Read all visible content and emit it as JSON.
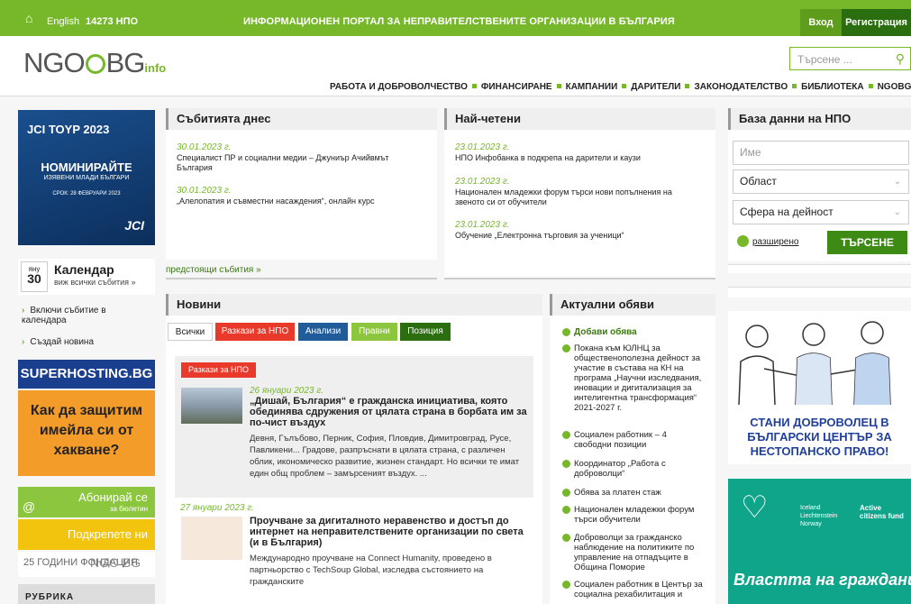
{
  "topbar": {
    "home_icon": "home-icon",
    "lang": "English",
    "count": "14273 НПО",
    "portal": "ИНФОРМАЦИОНЕН ПОРТАЛ ЗА НЕПРАВИТЕЛСТВЕНИТЕ ОРГАНИЗАЦИИ В БЪЛГАРИЯ",
    "login": "Вход",
    "register": "Регистрация"
  },
  "header": {
    "logo_main": "NGO",
    "logo_bg": "BG",
    "logo_info": "info",
    "search_placeholder": "Търсене ..."
  },
  "nav": [
    "РАБОТА И ДОБРОВОЛЧЕСТВО",
    "ФИНАНСИРАНЕ",
    "КАМПАНИИ",
    "ДАРИТЕЛИ",
    "ЗАКОНОДАТЕЛСТВО",
    "БИБЛИОТЕКА",
    "NGOBG Live"
  ],
  "left": {
    "jci": {
      "logo": "JCI TOYP 2023",
      "title": "НОМИНИРАЙТЕ",
      "subtitle": "ИЗЯВЕНИ МЛАДИ БЪЛГАРИ",
      "deadline": "СРОК: 28 ФЕВРУАРИ 2023",
      "brand": "JCI"
    },
    "calendar": {
      "month": "яну",
      "day": "30",
      "title": "Календар",
      "sub": "виж всички събития »"
    },
    "links": [
      "Включи събитие в календара",
      "Създай новина"
    ],
    "superhosting": "SUPERHOSTING.BG",
    "superhosting_text": "Как да защитим имейла си от хакване?",
    "subscribe": "Абонирай се",
    "subscribe_sub": "за бюлетин",
    "support": "Подкрепете ни",
    "anniv": "25 ГОДИНИ ФОНДАЦИЯ",
    "anniv_logo": "NGO BG",
    "rubric": "РУБРИКА"
  },
  "events": {
    "title": "Събитията днес",
    "items": [
      {
        "date": "30.01.2023 г.",
        "text": "Специалист ПР и социални медии – Джуниър Ачийвмът България"
      },
      {
        "date": "30.01.2023 г.",
        "text": "„Алелопатия и съвместни насаждения“, онлайн курс"
      }
    ],
    "upcoming": "предстоящи събития »"
  },
  "popular": {
    "title": "Най-четени",
    "items": [
      {
        "date": "23.01.2023 г.",
        "text": "НПО Инфобанка в подкрепа на дарители и каузи"
      },
      {
        "date": "23.01.2023 г.",
        "text": "Национален младежки форум търси нови попълнения на звеното си от обучители"
      },
      {
        "date": "23.01.2023 г.",
        "text": "Обучение „Електронна търговия за ученици“"
      }
    ]
  },
  "news": {
    "title": "Новини",
    "tabs": [
      "Всички",
      "Разкази за НПО",
      "Анализи",
      "Правни",
      "Позиция"
    ],
    "tab_colors": [
      "#ffffff",
      "#e8392a",
      "#1f5c99",
      "#8cc63f",
      "#2b6e10"
    ],
    "items": [
      {
        "tag": "Разкази за НПО",
        "date": "26 януари 2023 г.",
        "title": "„Дишай, България“ е гражданска инициатива, която обединява сдружения от цялата страна в борбата им за по-чист въздух",
        "text": "Девня, Гълъбово, Перник, София, Пловдив, Димитровград, Русе, Павликени... Градове, разпръснати в цялата страна, с различен облик, икономическо развитие, жизнен стандарт. Но всички те имат един общ проблем – замърсеният въздух. ..."
      },
      {
        "date": "27 януари 2023 г.",
        "title": "Проучване за дигиталното неравенство и достъп до интернет на неправителствените организации по света (и в България)",
        "text": "Международно проучване на Connect Humanity, проведено в партньорство с TechSoup Global, изследва състоянието на гражданските"
      }
    ]
  },
  "ads": {
    "title": "Актуални обяви",
    "add": "Добави обява",
    "items": [
      "Покана към ЮЛНЦ за общественополезна дейност за участие в състава на КН на програма „Научни изследвания, иновации и дигитализация за интелигентна трансформация“ 2021-2027 г.",
      "Социален работник – 4 свободни позиции",
      "Координатор „Работа с доброволци“",
      "Обява за платен стаж",
      "Национален младежки форум търси обучители",
      "Доброволци за гражданско наблюдение на политиките по управление на отпадъците в Община Поморие",
      "Социален работник в Център за социална рехабилитация и"
    ]
  },
  "db": {
    "title": "База данни на НПО",
    "name_placeholder": "Име",
    "region": "Област",
    "field": "Сфера на дейност",
    "advanced": "разширено",
    "search_btn": "ТЪРСЕНЕ"
  },
  "right_banners": {
    "volunteer": "СТАНИ ДОБРОВОЛЕЦ В БЪЛГАРСКИ ЦЕНТЪР ЗА НЕСТОПАНСКО ПРАВО!",
    "fund_left": "Iceland Liechtenstein Norway",
    "fund_right": "Active citizens fund",
    "slogan": "Властта на гражданите"
  }
}
